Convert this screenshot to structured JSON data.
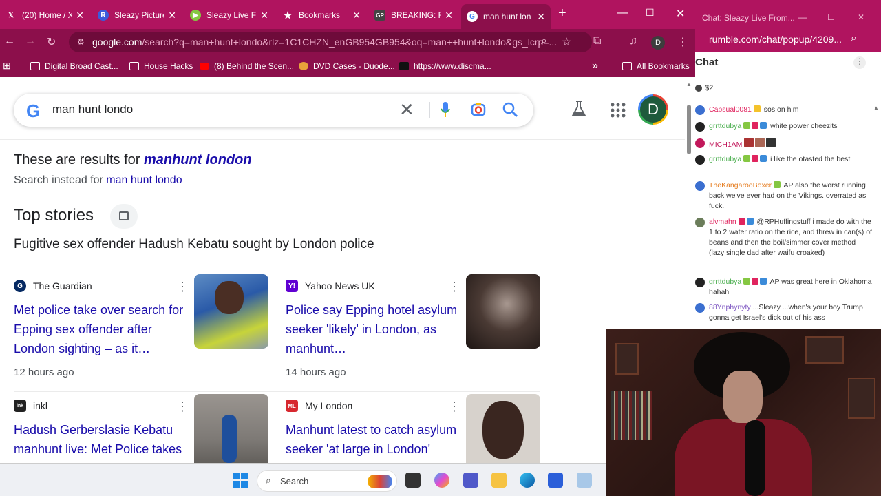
{
  "browser": {
    "tabs": [
      {
        "label": "(20) Home / X",
        "icon": "x-logo-icon",
        "color": "#000000"
      },
      {
        "label": "Sleazy Pictures",
        "icon": "r-logo-icon",
        "color": "#3b5bdb"
      },
      {
        "label": "Sleazy Live Fr…",
        "icon": "rumble-play-icon",
        "color": "#85c742"
      },
      {
        "label": "Bookmarks",
        "icon": "star-icon",
        "color": "#ffffff"
      },
      {
        "label": "BREAKING: FB",
        "icon": "gp-logo-icon",
        "color": "#444444"
      },
      {
        "label": "man hunt lon",
        "icon": "google-g-icon",
        "color": "#ffffff"
      }
    ],
    "new_tab": "+",
    "address": {
      "domain": "google.com",
      "path": "/search?q=man+hunt+londo&rlz=1C1CHZN_enGB954GB954&oq=man++hunt+londo&gs_lcrp=..."
    },
    "profile_initial": "D",
    "bookmarks": [
      {
        "label": "Digital Broad Cast...",
        "icon": "folder-icon"
      },
      {
        "label": "House Hacks",
        "icon": "folder-icon"
      },
      {
        "label": "(8) Behind the Scen...",
        "icon": "youtube-icon"
      },
      {
        "label": "DVD Cases - Duode...",
        "icon": "site-icon"
      },
      {
        "label": "https://www.discma...",
        "icon": "site-icon"
      }
    ],
    "all_bookmarks": "All Bookmarks",
    "overflow": "»"
  },
  "search": {
    "query": "man hunt londo",
    "avatar_initial": "D",
    "correction_prefix": "These are results for ",
    "correction_term": "manhunt london",
    "instead_prefix": "Search instead for ",
    "instead_term": "man hunt londo",
    "top_stories_title": "Top stories",
    "story_subtitle": "Fugitive sex offender Hadush Kebatu sought by London police",
    "stories": [
      {
        "source": "The Guardian",
        "headline": "Met police take over search for Epping sex offender after London sighting – as it…",
        "age": "12 hours ago",
        "fav": "G",
        "fav_color": "#052962"
      },
      {
        "source": "Yahoo News UK",
        "headline": "Police say Epping hotel asylum seeker 'likely' in London, as manhunt…",
        "age": "14 hours ago",
        "fav": "Y!",
        "fav_color": "#6001d2"
      },
      {
        "source": "inkl",
        "headline": "Hadush Gerberslasie Kebatu manhunt live: Met Police takes over search for sex…",
        "age": "",
        "fav": "ink",
        "fav_color": "#222222"
      },
      {
        "source": "My London",
        "headline": "Manhunt latest to catch asylum seeker 'at large in London' after prison release…",
        "age": "",
        "fav": "ML",
        "fav_color": "#d7282f"
      }
    ]
  },
  "chat": {
    "window_title": "Chat: Sleazy Live From...",
    "url": "rumble.com/chat/popup/4209...",
    "header": "Chat",
    "rant_amount": "$2",
    "messages": [
      {
        "user": "Capsual0081",
        "text": "sos on him",
        "color": "#e0245e",
        "avatar": "#3b6fd0"
      },
      {
        "user": "grrttdubya",
        "text": "white power cheezits",
        "color": "#4caf50",
        "avatar": "#222222"
      },
      {
        "user": "MICH1AM",
        "text": "",
        "color": "#c2185b",
        "avatar": "#c2185b"
      },
      {
        "user": "grrttdubya",
        "text": "i like the otasted the best",
        "color": "#4caf50",
        "avatar": "#222222"
      },
      {
        "user": "TheKangarooBoxer",
        "text": "AP also the worst running back we've ever had on the Vikings. overrated as fuck.",
        "color": "#e67e22",
        "avatar": "#3b6fd0"
      },
      {
        "user": "alvmahn",
        "text": "@RPHuffingstuff i made do with the 1 to 2 water ratio on the rice, and threw in can(s) of beans and then the boil/simmer cover method (lazy single dad after waifu croaked)",
        "color": "#e0245e",
        "avatar": "#6b7d5a"
      },
      {
        "user": "grrttdubya",
        "text": "AP was great here in Oklahoma hahah",
        "color": "#4caf50",
        "avatar": "#222222"
      },
      {
        "user": "88Ynphynyty",
        "text": "...Sleazy ...when's your boy Trump gonna get Israel's dick out of his ass",
        "color": "#7e57c2",
        "avatar": "#3b6fd0"
      }
    ]
  },
  "taskbar": {
    "search_label": "Search"
  }
}
